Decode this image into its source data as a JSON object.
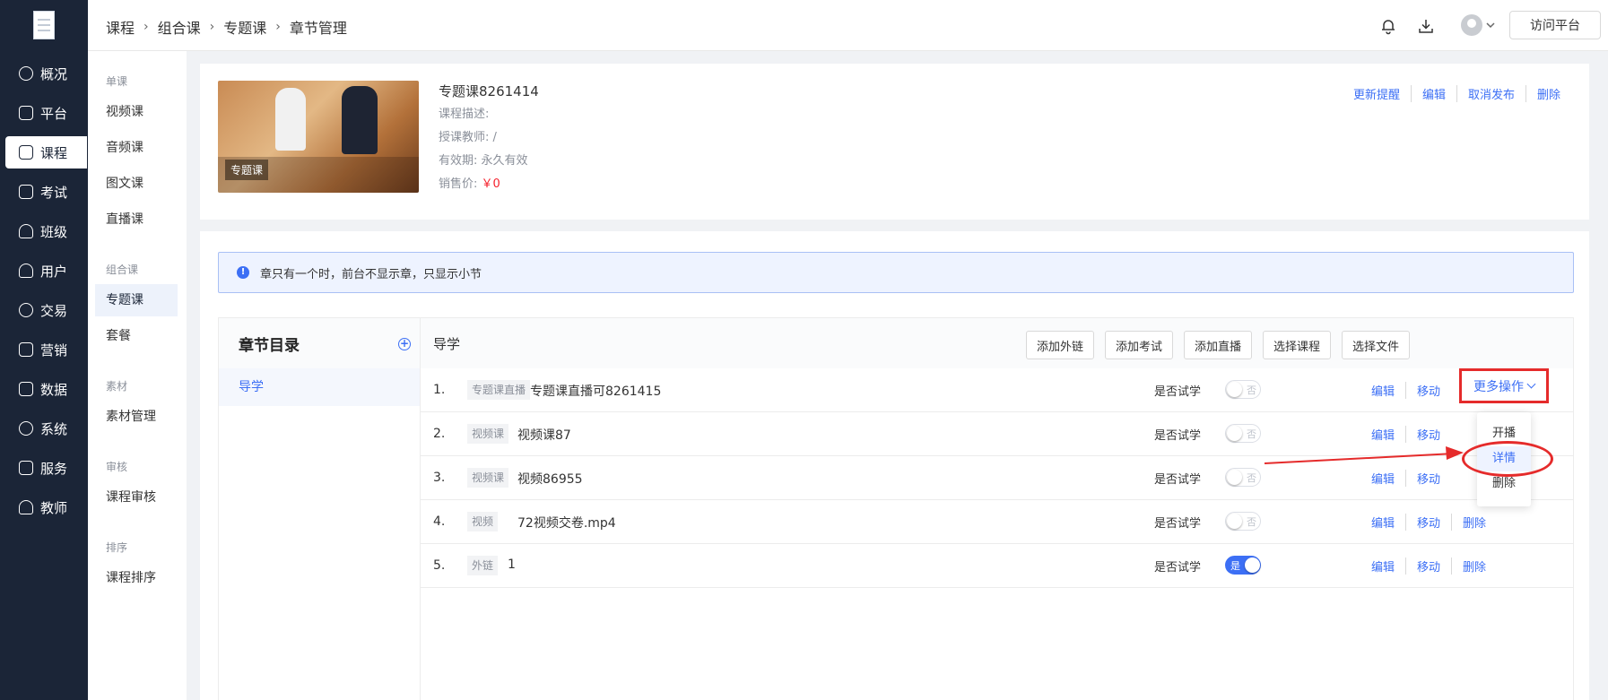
{
  "sidebar": {
    "items": [
      {
        "label": "概况",
        "icon": "overview-icon",
        "active": false
      },
      {
        "label": "平台",
        "icon": "platform-icon",
        "active": false
      },
      {
        "label": "课程",
        "icon": "course-icon",
        "active": true
      },
      {
        "label": "考试",
        "icon": "exam-icon",
        "active": false
      },
      {
        "label": "班级",
        "icon": "class-icon",
        "active": false
      },
      {
        "label": "用户",
        "icon": "user-icon",
        "active": false
      },
      {
        "label": "交易",
        "icon": "trade-icon",
        "active": false
      },
      {
        "label": "营销",
        "icon": "marketing-icon",
        "active": false
      },
      {
        "label": "数据",
        "icon": "data-icon",
        "active": false
      },
      {
        "label": "系统",
        "icon": "system-icon",
        "active": false
      },
      {
        "label": "服务",
        "icon": "service-icon",
        "active": false
      },
      {
        "label": "教师",
        "icon": "teacher-icon",
        "active": false
      }
    ]
  },
  "subnav": {
    "groups": [
      {
        "title": "单课",
        "items": [
          "视频课",
          "音频课",
          "图文课",
          "直播课"
        ]
      },
      {
        "title": "组合课",
        "items": [
          "专题课",
          "套餐"
        ]
      },
      {
        "title": "素材",
        "items": [
          "素材管理"
        ]
      },
      {
        "title": "审核",
        "items": [
          "课程审核"
        ]
      },
      {
        "title": "排序",
        "items": [
          "课程排序"
        ]
      }
    ],
    "active": "专题课"
  },
  "header": {
    "breadcrumb": [
      "课程",
      "组合课",
      "专题课",
      "章节管理"
    ],
    "visit_label": "访问平台",
    "icons": [
      "bell-icon",
      "download-icon",
      "avatar-icon",
      "chevron-down-icon"
    ]
  },
  "course": {
    "badge": "专题课",
    "name": "专题课8261414",
    "desc_label": "课程描述:",
    "desc_value": "",
    "teacher_label": "授课教师:",
    "teacher_value": "/",
    "valid_label": "有效期:",
    "valid_value": "永久有效",
    "price_label": "销售价:",
    "price_value": "￥0",
    "actions": [
      "更新提醒",
      "编辑",
      "取消发布",
      "删除"
    ]
  },
  "notice": {
    "text": "章只有一个时，前台不显示章，只显示小节"
  },
  "chapter_panel": {
    "title": "章节目录",
    "items": [
      "导学"
    ]
  },
  "lesson_panel": {
    "title": "导学",
    "toolbar": [
      "添加外链",
      "添加考试",
      "添加直播",
      "选择课程",
      "选择文件"
    ],
    "trial_label": "是否试学",
    "lessons": [
      {
        "index": "1.",
        "tag": "专题课直播",
        "name": "专题课直播可8261415",
        "trial": "否",
        "trial_on": false,
        "actions": [
          "编辑",
          "移动"
        ]
      },
      {
        "index": "2.",
        "tag": "视频课",
        "name": "视频课87",
        "trial": "否",
        "trial_on": false,
        "actions": [
          "编辑",
          "移动"
        ]
      },
      {
        "index": "3.",
        "tag": "视频课",
        "name": "视频86955",
        "trial": "否",
        "trial_on": false,
        "actions": [
          "编辑",
          "移动"
        ]
      },
      {
        "index": "4.",
        "tag": "视频",
        "name": "72视频交卷.mp4",
        "trial": "否",
        "trial_on": false,
        "actions": [
          "编辑",
          "移动",
          "删除"
        ]
      },
      {
        "index": "5.",
        "tag": "外链",
        "name": "1",
        "trial": "是",
        "trial_on": true,
        "actions": [
          "编辑",
          "移动",
          "删除"
        ]
      }
    ],
    "more_ops_label": "更多操作",
    "dropdown": [
      "开播",
      "详情",
      "删除"
    ],
    "dropdown_highlight": "详情"
  },
  "colors": {
    "sidebar_bg": "#1b2537",
    "accent": "#3c6ff5",
    "annotation_red": "#e52b2b",
    "price_red": "#f5222d"
  }
}
